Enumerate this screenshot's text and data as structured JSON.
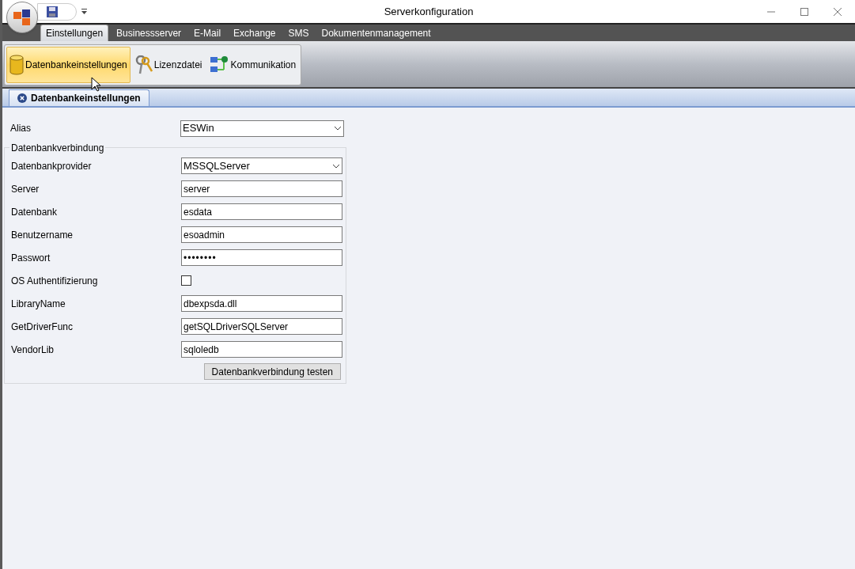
{
  "window": {
    "title": "Serverkonfiguration"
  },
  "ribbon_tabs": [
    {
      "label": "Einstellungen",
      "selected": true
    },
    {
      "label": "Businessserver",
      "selected": false
    },
    {
      "label": "E-Mail",
      "selected": false
    },
    {
      "label": "Exchange",
      "selected": false
    },
    {
      "label": "SMS",
      "selected": false
    },
    {
      "label": "Dokumentenmanagement",
      "selected": false
    }
  ],
  "ribbon_buttons": [
    {
      "label": "Datenbankeinstellungen",
      "kind": "database",
      "selected": true
    },
    {
      "label": "Lizenzdatei",
      "kind": "keys",
      "selected": false
    },
    {
      "label": "Kommunikation",
      "kind": "network",
      "selected": false
    }
  ],
  "document_tab": {
    "label": "Datenbankeinstellungen"
  },
  "alias": {
    "label": "Alias",
    "value": "ESWin"
  },
  "group": {
    "title": "Datenbankverbindung",
    "fields": [
      {
        "label": "Datenbankprovider",
        "kind": "dropdown",
        "value": "MSSQLServer"
      },
      {
        "label": "Server",
        "kind": "text",
        "value": "server"
      },
      {
        "label": "Datenbank",
        "kind": "text",
        "value": "esdata"
      },
      {
        "label": "Benutzername",
        "kind": "text",
        "value": "esoadmin"
      },
      {
        "label": "Passwort",
        "kind": "password",
        "value": "••••••••"
      },
      {
        "label": "OS Authentifizierung",
        "kind": "checkbox",
        "checked": false
      },
      {
        "label": "LibraryName",
        "kind": "text",
        "value": "dbexpsda.dll"
      },
      {
        "label": "GetDriverFunc",
        "kind": "text",
        "value": "getSQLDriverSQLServer"
      },
      {
        "label": "VendorLib",
        "kind": "text",
        "value": "sqloledb"
      }
    ],
    "button": "Datenbankverbindung testen"
  }
}
